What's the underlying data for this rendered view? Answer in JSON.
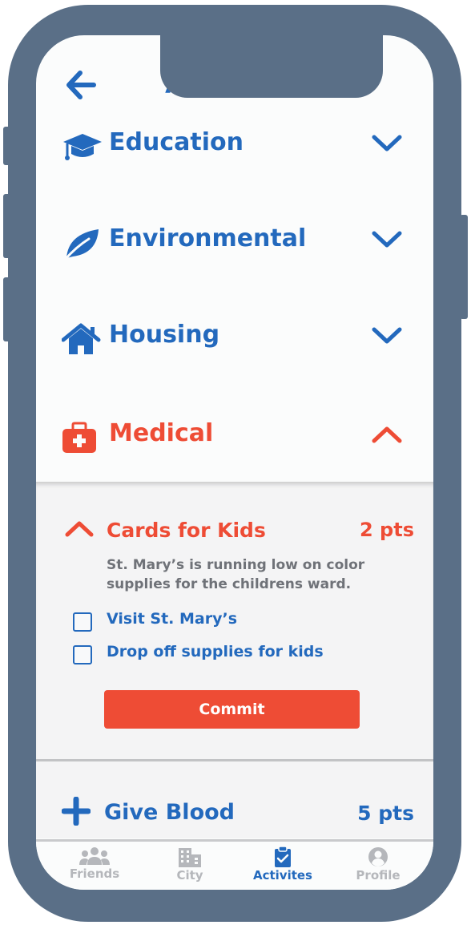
{
  "header": {
    "title": "Activities"
  },
  "categories": [
    {
      "label": "Education",
      "icon": "graduation-cap-icon",
      "expanded": false
    },
    {
      "label": "Environmental",
      "icon": "leaf-icon",
      "expanded": false
    },
    {
      "label": "Housing",
      "icon": "house-icon",
      "expanded": false
    },
    {
      "label": "Medical",
      "icon": "medical-kit-icon",
      "expanded": true
    }
  ],
  "activity": {
    "title": "Cards for Kids",
    "points": "2 pts",
    "description": "St. Mary’s is running low on color supplies for the childrens ward.",
    "tasks": [
      {
        "label": "Visit St. Mary’s",
        "checked": false
      },
      {
        "label": "Drop off supplies for kids",
        "checked": false
      }
    ],
    "commit_label": "Commit"
  },
  "next_activity": {
    "title": "Give Blood",
    "points": "5 pts"
  },
  "tabs": [
    {
      "label": "Friends",
      "icon": "friends-icon",
      "active": false
    },
    {
      "label": "City",
      "icon": "city-icon",
      "active": false
    },
    {
      "label": "Activites",
      "icon": "clipboard-check-icon",
      "active": true
    },
    {
      "label": "Profile",
      "icon": "profile-icon",
      "active": false
    }
  ],
  "colors": {
    "primary": "#2369bd",
    "accent": "#ee4c35",
    "frame": "#5a6f87",
    "inactive": "#b5b7bb"
  }
}
